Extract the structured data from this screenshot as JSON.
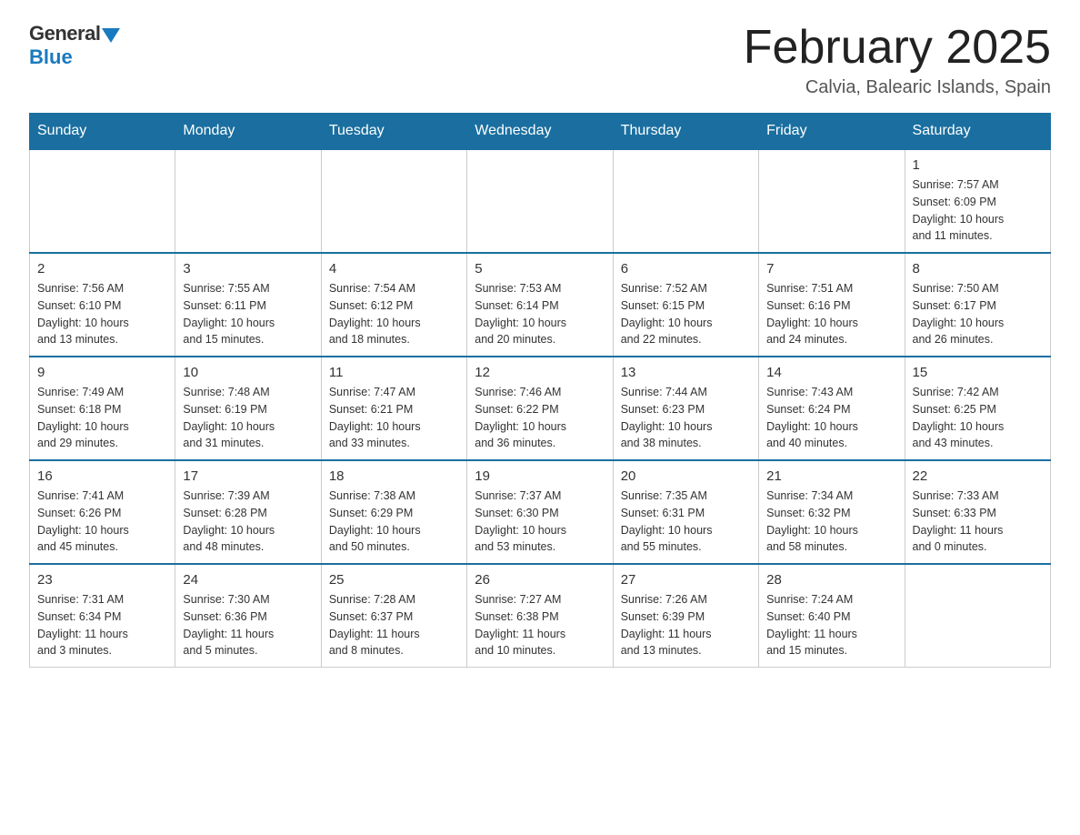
{
  "header": {
    "logo_general": "General",
    "logo_blue": "Blue",
    "month_title": "February 2025",
    "location": "Calvia, Balearic Islands, Spain"
  },
  "weekdays": [
    "Sunday",
    "Monday",
    "Tuesday",
    "Wednesday",
    "Thursday",
    "Friday",
    "Saturday"
  ],
  "weeks": [
    [
      {
        "day": "",
        "info": ""
      },
      {
        "day": "",
        "info": ""
      },
      {
        "day": "",
        "info": ""
      },
      {
        "day": "",
        "info": ""
      },
      {
        "day": "",
        "info": ""
      },
      {
        "day": "",
        "info": ""
      },
      {
        "day": "1",
        "info": "Sunrise: 7:57 AM\nSunset: 6:09 PM\nDaylight: 10 hours\nand 11 minutes."
      }
    ],
    [
      {
        "day": "2",
        "info": "Sunrise: 7:56 AM\nSunset: 6:10 PM\nDaylight: 10 hours\nand 13 minutes."
      },
      {
        "day": "3",
        "info": "Sunrise: 7:55 AM\nSunset: 6:11 PM\nDaylight: 10 hours\nand 15 minutes."
      },
      {
        "day": "4",
        "info": "Sunrise: 7:54 AM\nSunset: 6:12 PM\nDaylight: 10 hours\nand 18 minutes."
      },
      {
        "day": "5",
        "info": "Sunrise: 7:53 AM\nSunset: 6:14 PM\nDaylight: 10 hours\nand 20 minutes."
      },
      {
        "day": "6",
        "info": "Sunrise: 7:52 AM\nSunset: 6:15 PM\nDaylight: 10 hours\nand 22 minutes."
      },
      {
        "day": "7",
        "info": "Sunrise: 7:51 AM\nSunset: 6:16 PM\nDaylight: 10 hours\nand 24 minutes."
      },
      {
        "day": "8",
        "info": "Sunrise: 7:50 AM\nSunset: 6:17 PM\nDaylight: 10 hours\nand 26 minutes."
      }
    ],
    [
      {
        "day": "9",
        "info": "Sunrise: 7:49 AM\nSunset: 6:18 PM\nDaylight: 10 hours\nand 29 minutes."
      },
      {
        "day": "10",
        "info": "Sunrise: 7:48 AM\nSunset: 6:19 PM\nDaylight: 10 hours\nand 31 minutes."
      },
      {
        "day": "11",
        "info": "Sunrise: 7:47 AM\nSunset: 6:21 PM\nDaylight: 10 hours\nand 33 minutes."
      },
      {
        "day": "12",
        "info": "Sunrise: 7:46 AM\nSunset: 6:22 PM\nDaylight: 10 hours\nand 36 minutes."
      },
      {
        "day": "13",
        "info": "Sunrise: 7:44 AM\nSunset: 6:23 PM\nDaylight: 10 hours\nand 38 minutes."
      },
      {
        "day": "14",
        "info": "Sunrise: 7:43 AM\nSunset: 6:24 PM\nDaylight: 10 hours\nand 40 minutes."
      },
      {
        "day": "15",
        "info": "Sunrise: 7:42 AM\nSunset: 6:25 PM\nDaylight: 10 hours\nand 43 minutes."
      }
    ],
    [
      {
        "day": "16",
        "info": "Sunrise: 7:41 AM\nSunset: 6:26 PM\nDaylight: 10 hours\nand 45 minutes."
      },
      {
        "day": "17",
        "info": "Sunrise: 7:39 AM\nSunset: 6:28 PM\nDaylight: 10 hours\nand 48 minutes."
      },
      {
        "day": "18",
        "info": "Sunrise: 7:38 AM\nSunset: 6:29 PM\nDaylight: 10 hours\nand 50 minutes."
      },
      {
        "day": "19",
        "info": "Sunrise: 7:37 AM\nSunset: 6:30 PM\nDaylight: 10 hours\nand 53 minutes."
      },
      {
        "day": "20",
        "info": "Sunrise: 7:35 AM\nSunset: 6:31 PM\nDaylight: 10 hours\nand 55 minutes."
      },
      {
        "day": "21",
        "info": "Sunrise: 7:34 AM\nSunset: 6:32 PM\nDaylight: 10 hours\nand 58 minutes."
      },
      {
        "day": "22",
        "info": "Sunrise: 7:33 AM\nSunset: 6:33 PM\nDaylight: 11 hours\nand 0 minutes."
      }
    ],
    [
      {
        "day": "23",
        "info": "Sunrise: 7:31 AM\nSunset: 6:34 PM\nDaylight: 11 hours\nand 3 minutes."
      },
      {
        "day": "24",
        "info": "Sunrise: 7:30 AM\nSunset: 6:36 PM\nDaylight: 11 hours\nand 5 minutes."
      },
      {
        "day": "25",
        "info": "Sunrise: 7:28 AM\nSunset: 6:37 PM\nDaylight: 11 hours\nand 8 minutes."
      },
      {
        "day": "26",
        "info": "Sunrise: 7:27 AM\nSunset: 6:38 PM\nDaylight: 11 hours\nand 10 minutes."
      },
      {
        "day": "27",
        "info": "Sunrise: 7:26 AM\nSunset: 6:39 PM\nDaylight: 11 hours\nand 13 minutes."
      },
      {
        "day": "28",
        "info": "Sunrise: 7:24 AM\nSunset: 6:40 PM\nDaylight: 11 hours\nand 15 minutes."
      },
      {
        "day": "",
        "info": ""
      }
    ]
  ]
}
